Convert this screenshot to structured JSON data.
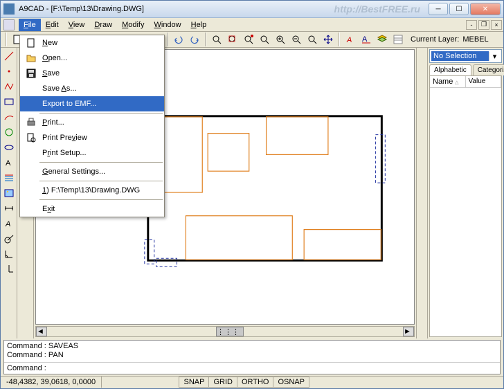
{
  "window": {
    "title": "A9CAD - [F:\\Temp\\13\\Drawing.DWG]",
    "watermark": "http://BestFREE.ru"
  },
  "menubar": {
    "items": [
      "File",
      "Edit",
      "View",
      "Draw",
      "Modify",
      "Window",
      "Help"
    ]
  },
  "file_menu": {
    "new": "New",
    "open": "Open...",
    "save": "Save",
    "save_as": "Save As...",
    "export": "Export to EMF...",
    "print": "Print...",
    "preview": "Print Preview",
    "setup": "Print Setup...",
    "settings": "General Settings...",
    "recent": "1) F:\\Temp\\13\\Drawing.DWG",
    "exit": "Exit"
  },
  "toolbar": {
    "current_layer_label": "Current Layer:",
    "current_layer_value": "MEBEL"
  },
  "properties": {
    "selection": "No Selection",
    "tab_alpha": "Alphabetic",
    "tab_cat": "Categorized",
    "col_name": "Name",
    "col_value": "Value"
  },
  "command": {
    "history": [
      "Command : SAVEAS",
      "Command : PAN"
    ],
    "prompt": "Command :"
  },
  "status": {
    "coords": "-48,4382, 39,0618, 0,0000",
    "snap": "SNAP",
    "grid": "GRID",
    "ortho": "ORTHO",
    "osnap": "OSNAP"
  }
}
